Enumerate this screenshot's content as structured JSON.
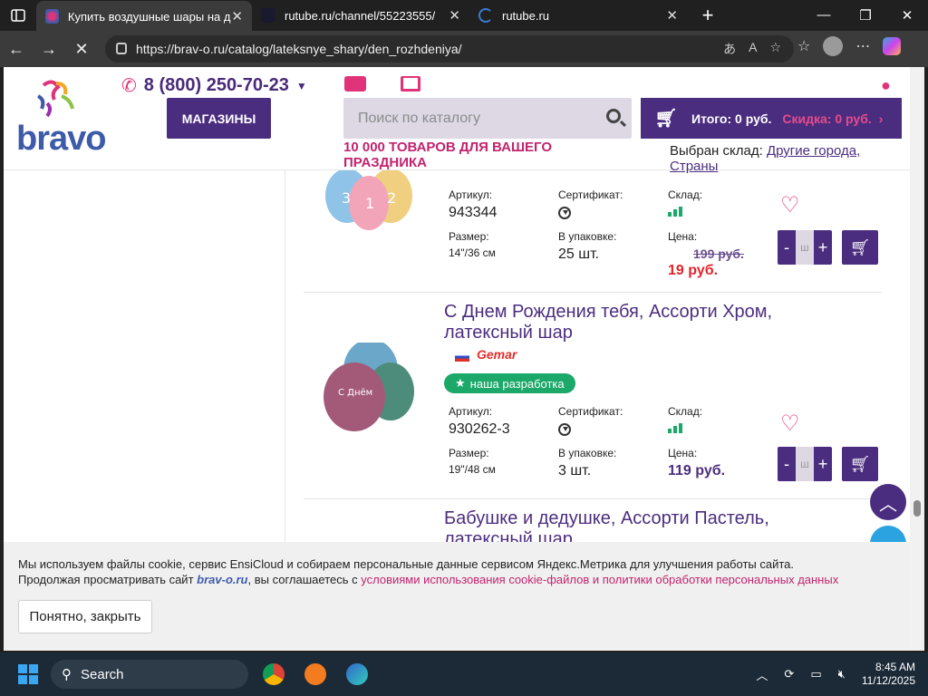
{
  "browser": {
    "tabs": [
      {
        "title": "Купить воздушные шары на ден",
        "active": true
      },
      {
        "title": "rutube.ru/channel/55223555/",
        "active": false
      },
      {
        "title": "rutube.ru",
        "active": false
      }
    ],
    "url": "https://brav-o.ru/catalog/lateksnye_shary/den_rozhdeniya/"
  },
  "header": {
    "logo_text": "bravo",
    "phone": "8 (800) 250-70-23",
    "stores_button": "МАГАЗИНЫ",
    "search_placeholder": "Поиск по каталогу",
    "cart_total": "Итого: 0 руб.",
    "cart_discount": "Скидка: 0 руб.",
    "promo": "10 000 ТОВАРОВ ДЛЯ ВАШЕГО ПРАЗДНИКА",
    "warehouse_label": "Выбран склад:",
    "warehouse_value": "Другие города, Страны"
  },
  "labels": {
    "article": "Артикул:",
    "certificate": "Сертификат:",
    "stock": "Склад:",
    "size": "Размер:",
    "pack": "В упаковке:",
    "price": "Цена:",
    "qty_minus": "-",
    "qty_plus": "+",
    "qty_placeholder": "ш"
  },
  "products": [
    {
      "article": "943344",
      "size": "14\"/36 см",
      "pack": "25 шт.",
      "old_price": "199 руб.",
      "price": "19 руб."
    },
    {
      "title": "С Днем Рождения тебя, Ассорти Хром, латексный шар",
      "brand": "Gemar",
      "badge": "наша разработка",
      "article": "930262-3",
      "size": "19\"/48 см",
      "pack": "3 шт.",
      "price": "119 руб."
    },
    {
      "title": "Бабушке и дедушке, Ассорти Пастель, латексный шар"
    }
  ],
  "cookie": {
    "text1": "Мы используем файлы cookie, сервис EnsiCloud и собираем персональные данные сервисом Яндекс.Метрика для улучшения работы сайта.",
    "text2_a": "Продолжая просматривать сайт",
    "text2_site": "brav-o.ru",
    "text2_b": ", вы соглашаетесь с",
    "link": "условиями использования cookie-файлов и политики обработки персональных данных",
    "button": "Понятно, закрыть"
  },
  "taskbar": {
    "search": "Search",
    "time": "8:45 AM",
    "date": "11/12/2025"
  },
  "colors": {
    "brand_purple": "#4b2d7f",
    "accent_pink": "#e0337a",
    "sale_red": "#e2232a",
    "badge_green": "#1ba869"
  }
}
